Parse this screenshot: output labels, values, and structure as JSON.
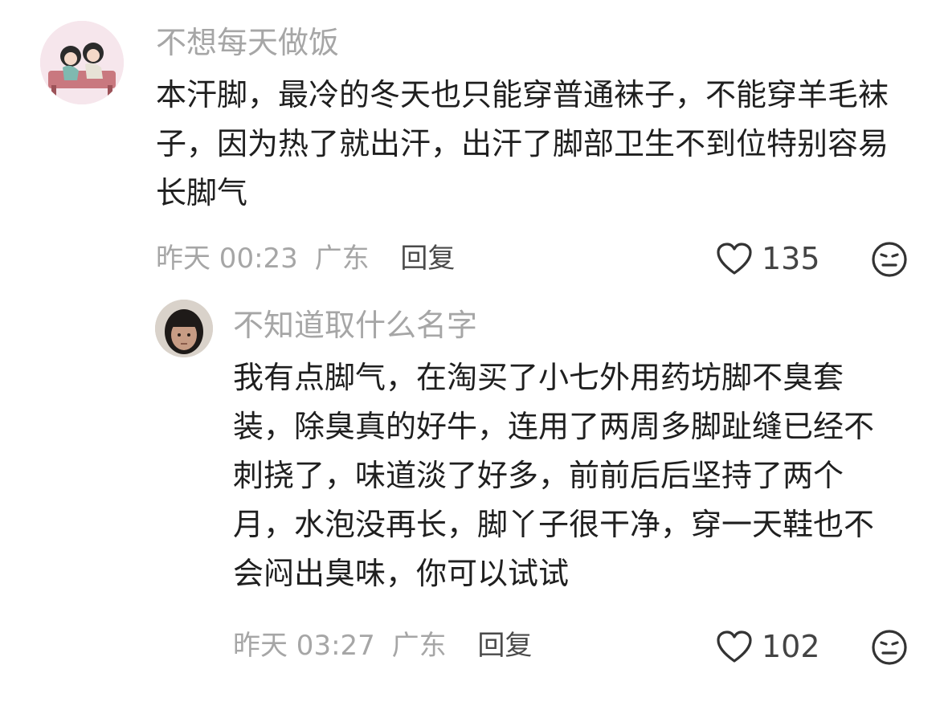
{
  "comments": [
    {
      "username": "不想每天做饭",
      "text": "本汗脚，最冷的冬天也只能穿普通袜子，不能穿羊毛袜子，因为热了就出汗，出汗了脚部卫生不到位特别容易长脚气",
      "time": "昨天 00:23",
      "location": "广东",
      "reply_label": "回复",
      "likes": "135"
    },
    {
      "username": "不知道取什么名字",
      "text": "我有点脚气，在淘买了小七外用药坊脚不臭套装，除臭真的好牛，连用了两周多脚趾缝已经不刺挠了，味道淡了好多，前前后后坚持了两个月，水泡没再长，脚丫子很干净，穿一天鞋也不会闷出臭味，你可以试试",
      "time": "昨天 03:27",
      "location": "广东",
      "reply_label": "回复",
      "likes": "102"
    }
  ],
  "icons": {
    "like": "heart-outline-icon",
    "reaction": "neutral-face-icon"
  },
  "colors": {
    "username": "#a6a6a6",
    "text": "#1f1f1f",
    "meta": "#a6a6a6",
    "reply": "#4a4a4a"
  }
}
